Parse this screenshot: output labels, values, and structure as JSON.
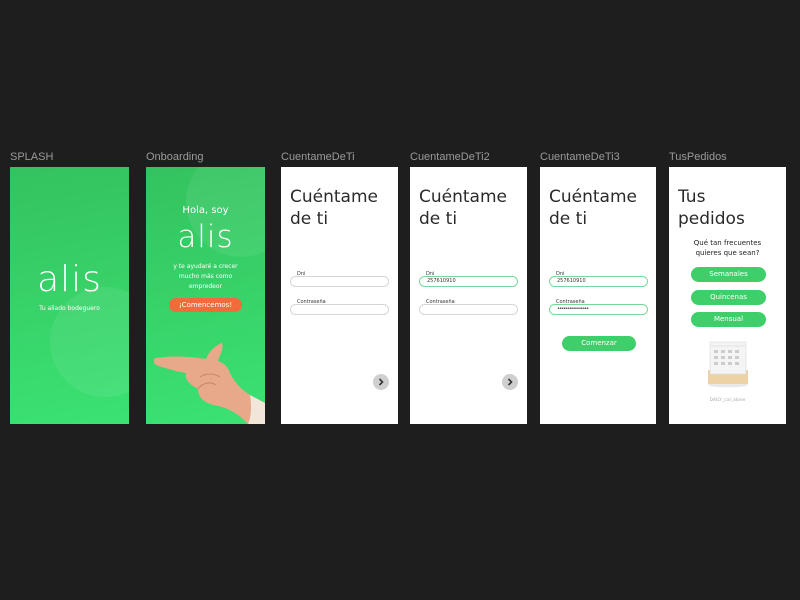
{
  "frames": {
    "splash": {
      "label": "SPLASH",
      "logo": "alis",
      "tagline": "Tu aliado bodeguero"
    },
    "onboarding": {
      "label": "Onboarding",
      "greeting": "Hola, soy",
      "logo": "alis",
      "desc_line1": "y te ayudaré a crecer",
      "desc_line2": "mucho más como",
      "desc_line3": "empredeor",
      "cta": "¡Comencemos!"
    },
    "cuentame1": {
      "label": "CuentameDeTi",
      "title_line1": "Cuéntame",
      "title_line2": "de ti",
      "dni_label": "Dni",
      "dni_value": "",
      "password_label": "Contraseña",
      "password_value": ""
    },
    "cuentame2": {
      "label": "CuentameDeTi2",
      "title_line1": "Cuéntame",
      "title_line2": "de ti",
      "dni_label": "Dni",
      "dni_value": "257610910",
      "password_label": "Contraseña",
      "password_value": ""
    },
    "cuentame3": {
      "label": "CuentameDeTi3",
      "title_line1": "Cuéntame",
      "title_line2": "de ti",
      "dni_label": "Dni",
      "dni_value": "257610910",
      "password_label": "Contraseña",
      "password_value": "••••••••••••••••",
      "cta": "Comenzar"
    },
    "pedidos": {
      "label": "TusPedidos",
      "title_line1": "Tus",
      "title_line2": "pedidos",
      "question_line1": "Qué tan frecuentes",
      "question_line2": "quieres que sean?",
      "options": [
        "Semanales",
        "Quincenas",
        "Mensual"
      ],
      "image_caption": "DAILY_cal_alone"
    }
  },
  "colors": {
    "green": "#3fcf6a",
    "orange": "#f26b3a",
    "canvas": "#1e1e1e"
  },
  "icons": {
    "next": "chevron-right-icon",
    "calendar": "calendar-icon"
  }
}
